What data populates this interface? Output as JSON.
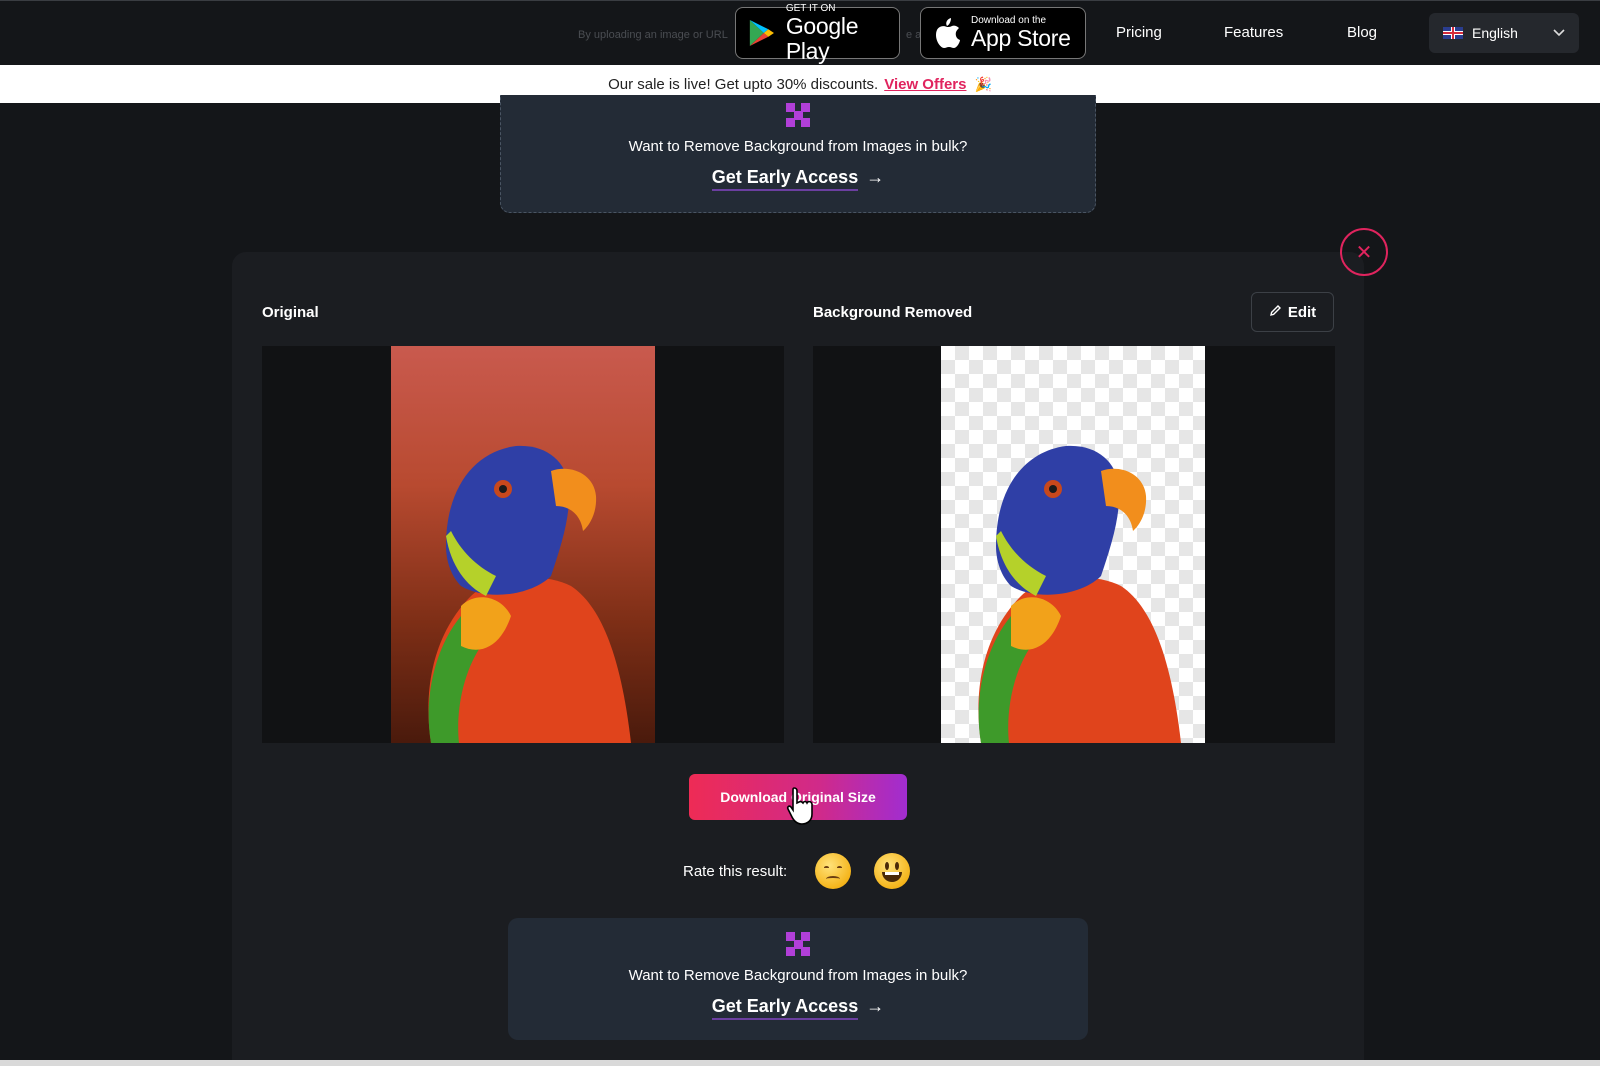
{
  "nav": {
    "upload_note_left": "By uploading an image or URL",
    "upload_note_right": "e a",
    "google_play": {
      "small": "GET IT ON",
      "big": "Google Play"
    },
    "app_store": {
      "small": "Download on the",
      "big": "App Store"
    },
    "links": [
      "Pricing",
      "Features",
      "Blog"
    ],
    "language": "English"
  },
  "sale_banner": {
    "text": "Our sale is live! Get upto 30% discounts.",
    "link": "View Offers",
    "emoji": "🎉"
  },
  "promo": {
    "question": "Want to Remove Background from Images in bulk?",
    "cta": "Get Early Access",
    "arrow": "→"
  },
  "result": {
    "original_label": "Original",
    "removed_label": "Background Removed",
    "edit_label": "Edit",
    "close_symbol": "✕",
    "download_label": "Download Original Size",
    "rate_label": "Rate this result:"
  },
  "colors": {
    "accent": "#e0245e",
    "gradient_start": "#ee2b55",
    "gradient_end": "#a12dd0",
    "promo_bg": "#232b36",
    "page_bg": "#141619"
  }
}
